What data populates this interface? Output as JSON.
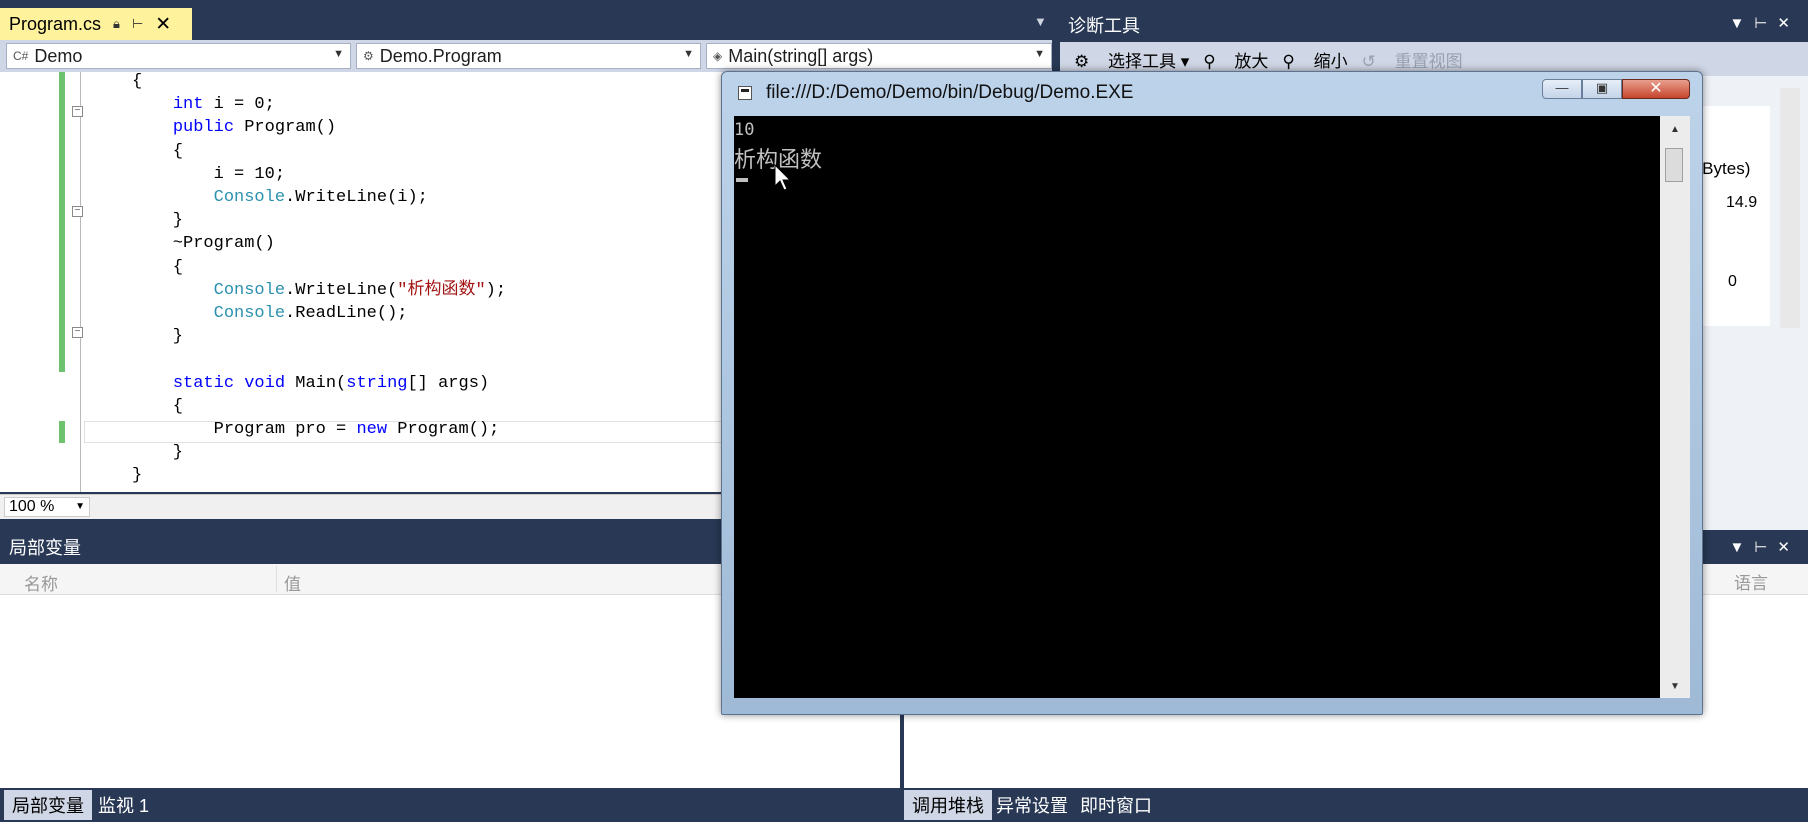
{
  "editor": {
    "tab": {
      "filename": "Program.cs",
      "pin_icon": "pin-icon",
      "close_icon": "close-icon"
    },
    "nav": {
      "project": "Demo",
      "class": "Demo.Program",
      "member": "Main(string[] args)"
    },
    "zoom": "100 %",
    "code_lines": [
      "{",
      "    int i = 0;",
      "    public Program()",
      "    {",
      "        i = 10;",
      "        Console.WriteLine(i);",
      "    }",
      "    ~Program()",
      "    {",
      "        Console.WriteLine(\"析构函数\");",
      "        Console.ReadLine();",
      "    }",
      "",
      "    static void Main(string[] args)",
      "    {",
      "        Program pro = new Program();",
      "    }",
      "}"
    ]
  },
  "diagnostics": {
    "title": "诊断工具",
    "toolbar": {
      "select_tool": "选择工具",
      "zoom_in": "放大",
      "zoom_out": "缩小",
      "reset_view": "重置视图"
    },
    "bytes_label": "e Bytes)",
    "value1": "14.9",
    "value2": "0"
  },
  "locals": {
    "title": "局部变量",
    "col_name": "名称",
    "col_value": "值"
  },
  "right_panel": {
    "col_lang": "语言"
  },
  "bottom_tabs_left": [
    {
      "label": "局部变量",
      "active": true
    },
    {
      "label": "监视 1",
      "active": false
    }
  ],
  "bottom_tabs_right": [
    {
      "label": "调用堆栈",
      "active": true
    },
    {
      "label": "异常设置",
      "active": false
    },
    {
      "label": "即时窗口",
      "active": false
    }
  ],
  "console": {
    "title": "file:///D:/Demo/Demo/bin/Debug/Demo.EXE",
    "output": [
      "10",
      "析构函数"
    ]
  },
  "colors": {
    "vs_chrome": "#293955",
    "active_tab": "#fff29d",
    "keyword": "#0000ff",
    "type": "#2b91af",
    "string": "#a31515",
    "change_marker": "#6ec26e"
  }
}
